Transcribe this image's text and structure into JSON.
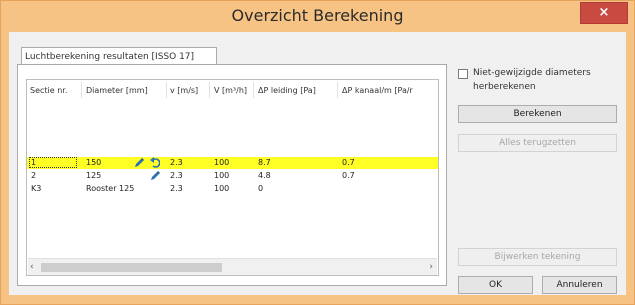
{
  "window": {
    "title": "Overzicht Berekening",
    "close_glyph": "×",
    "accent_color": "#c84a41",
    "frame_color": "#f7c384"
  },
  "tab": {
    "label": "Luchtberekening resultaten [ISSO 17]"
  },
  "table": {
    "headers": [
      "Sectie nr.",
      "Diameter [mm]",
      "v [m/s]",
      "V [m³/h]",
      "ΔP leiding [Pa]",
      "ΔP kanaal/m [Pa/r"
    ],
    "rows": [
      {
        "sectie": "1",
        "diameter": "150",
        "v": "2.3",
        "flow": "100",
        "dp_leiding": "8.7",
        "dp_kanaal": "0.7",
        "selected": true,
        "icons": [
          "pencil-icon",
          "undo-icon"
        ]
      },
      {
        "sectie": "2",
        "diameter": "125",
        "v": "2.3",
        "flow": "100",
        "dp_leiding": "4.8",
        "dp_kanaal": "0.7",
        "selected": false,
        "icons": [
          "pencil-icon"
        ]
      },
      {
        "sectie": "K3",
        "diameter": "Rooster 125",
        "v": "2.3",
        "flow": "100",
        "dp_leiding": "0",
        "dp_kanaal": "",
        "selected": false,
        "icons": []
      }
    ],
    "selected_row_color": "#ffff25",
    "scroll_left": "‹",
    "scroll_right": "›"
  },
  "options": {
    "recalc_checkbox_label": "Niet-gewijzigde diameters herberekenen",
    "recalc_checked": false
  },
  "buttons": {
    "berekenen": "Berekenen",
    "alles_terugzetten": "Alles terugzetten",
    "bijwerken_tekening": "Bijwerken tekening",
    "ok": "OK",
    "annuleren": "Annuleren"
  }
}
